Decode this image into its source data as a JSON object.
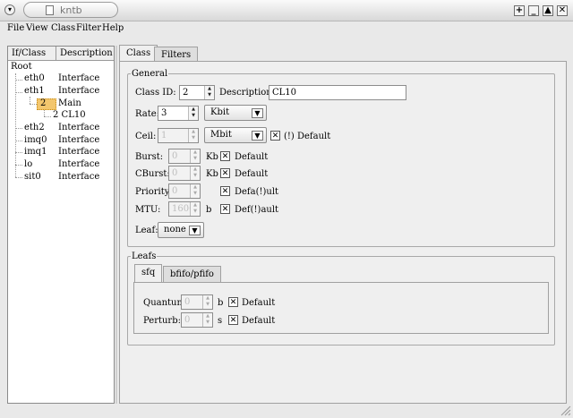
{
  "window": {
    "title": "kntb",
    "menu_button": "▾",
    "controls": [
      "+",
      "_",
      "▲",
      "✕"
    ]
  },
  "menubar": {
    "items": [
      {
        "label": "File"
      },
      {
        "label": "View"
      },
      {
        "label": "Class"
      },
      {
        "label": "Filter"
      },
      {
        "label": "Help"
      }
    ]
  },
  "tree": {
    "columns": [
      "If/Class",
      "Description"
    ],
    "root": "Root",
    "rows": [
      {
        "name": "eth0",
        "desc": "Interface"
      },
      {
        "name": "eth1",
        "desc": "Interface"
      },
      {
        "name": "2",
        "desc": "Main"
      },
      {
        "name": "2 CL10",
        "desc": ""
      },
      {
        "name": "eth2",
        "desc": "Interface"
      },
      {
        "name": "imq0",
        "desc": "Interface"
      },
      {
        "name": "imq1",
        "desc": "Interface"
      },
      {
        "name": "lo",
        "desc": "Interface"
      },
      {
        "name": "sit0",
        "desc": "Interface"
      }
    ]
  },
  "tabs": {
    "class": "Class",
    "filters": "Filters"
  },
  "general": {
    "legend": "General",
    "class_id_label": "Class ID:",
    "class_id_value": "2",
    "description_label": "Description:",
    "description_value": "CL10",
    "rate_label": "Rate:",
    "rate_value": "3",
    "rate_unit": "Kbit",
    "ceil_label": "Ceil:",
    "ceil_value": "1",
    "ceil_unit": "Mbit",
    "ceil_default_label": "(!) Default",
    "burst_label": "Burst:",
    "burst_value": "0",
    "burst_unit": "Kb",
    "burst_default_label": "Default",
    "cburst_label": "CBurst:",
    "cburst_value": "0",
    "cburst_unit": "Kb",
    "cburst_default_label": "Default",
    "priority_label": "Priority:",
    "priority_value": "0",
    "priority_default_label": "Defa(!)ult",
    "mtu_label": "MTU:",
    "mtu_value": "1600",
    "mtu_unit": "b",
    "mtu_default_label": "Def(!)ault",
    "leaf_label": "Leaf:",
    "leaf_value": "none"
  },
  "leafs": {
    "legend": "Leafs",
    "tab_sfq": "sfq",
    "tab_bfifo": "bfifo/pfifo",
    "quantum_label": "Quantum:",
    "quantum_value": "0",
    "quantum_unit": "b",
    "quantum_default_label": "Default",
    "perturb_label": "Perturb:",
    "perturb_value": "0",
    "perturb_unit": "s",
    "perturb_default_label": "Default"
  },
  "checkmark": "✕"
}
